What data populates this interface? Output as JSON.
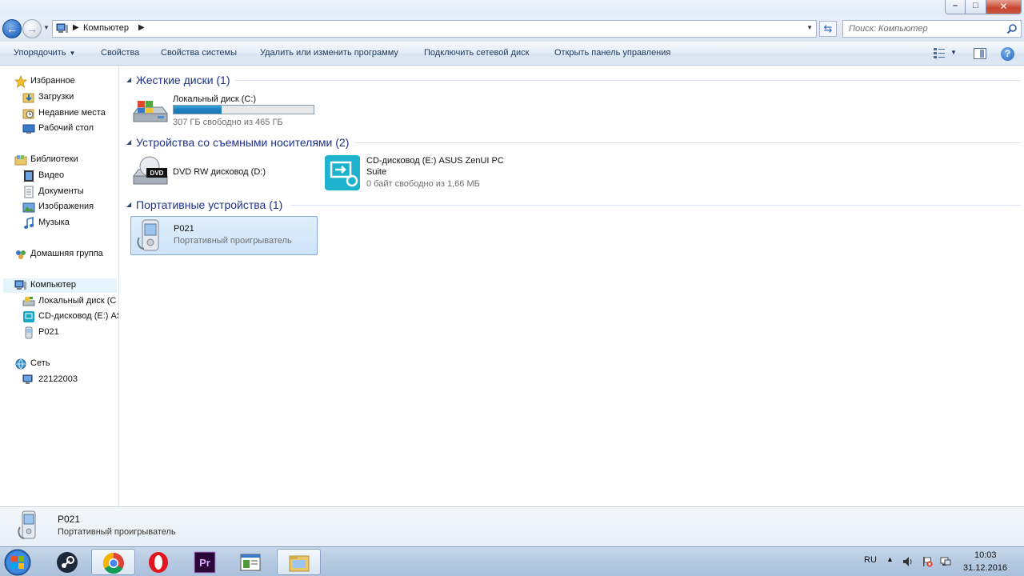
{
  "window": {
    "minimize_glyph": "–",
    "maximize_glyph": "□",
    "close_glyph": "✕"
  },
  "address": {
    "location": "Компьютер",
    "search_placeholder": "Поиск: Компьютер"
  },
  "toolbar": {
    "organize": "Упорядочить",
    "properties": "Свойства",
    "system_properties": "Свойства системы",
    "uninstall": "Удалить или изменить программу",
    "map_drive": "Подключить сетевой диск",
    "control_panel": "Открыть панель управления",
    "help_glyph": "?"
  },
  "nav": {
    "favorites": "Избранное",
    "downloads": "Загрузки",
    "recent": "Недавние места",
    "desktop": "Рабочий стол",
    "libraries": "Библиотеки",
    "video": "Видео",
    "documents": "Документы",
    "pictures": "Изображения",
    "music": "Музыка",
    "homegroup": "Домашняя группа",
    "computer": "Компьютер",
    "local_disk": "Локальный диск (C",
    "cd_drive": "CD-дисковод (E:) AS",
    "device": "P021",
    "network": "Сеть",
    "network_pc": "22122003"
  },
  "groups": {
    "hard_disks": "Жесткие диски (1)",
    "removable": "Устройства со съемными носителями (2)",
    "portable": "Портативные устройства (1)"
  },
  "items": {
    "disk_c": {
      "name": "Локальный диск (C:)",
      "free": "307 ГБ свободно из 465 ГБ",
      "used_fraction": 0.34
    },
    "dvd": {
      "name": "DVD RW дисковод (D:)"
    },
    "cd": {
      "name_line1": "CD-дисковод (E:) ASUS ZenUI PC",
      "name_line2": "Suite",
      "free": "0 байт свободно из 1,66 МБ"
    },
    "p021": {
      "name": "P021",
      "type": "Портативный проигрыватель"
    }
  },
  "details": {
    "name": "P021",
    "type": "Портативный проигрыватель"
  },
  "taskbar": {
    "lang": "RU",
    "time": "10:03",
    "date": "31.12.2016"
  },
  "colors": {
    "accent": "#1e3287",
    "bar_fill": "#1b7fc0",
    "selection": "#cee4f9"
  }
}
